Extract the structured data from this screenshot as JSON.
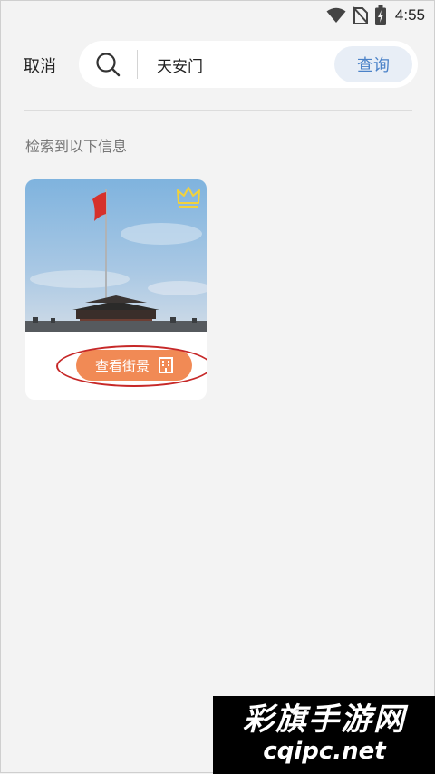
{
  "status_bar": {
    "time": "4:55",
    "icons": [
      "wifi-icon",
      "no-sim-icon",
      "battery-charging-icon"
    ]
  },
  "search": {
    "cancel_label": "取消",
    "query_value": "天安门",
    "submit_label": "查询",
    "search_icon": "search-icon"
  },
  "results": {
    "label": "检索到以下信息",
    "items": [
      {
        "image": "tiananmen-square-photo",
        "badge_icon": "crown-icon",
        "action_label": "查看街景",
        "action_icon": "building-icon"
      }
    ]
  },
  "colors": {
    "accent_button": "#f18a55",
    "query_button_text": "#4b82c8",
    "highlight": "#c62828",
    "crown": "#f2d23b"
  },
  "watermark": {
    "title": "彩旗手游网",
    "subtitle": "cqipc.net"
  }
}
